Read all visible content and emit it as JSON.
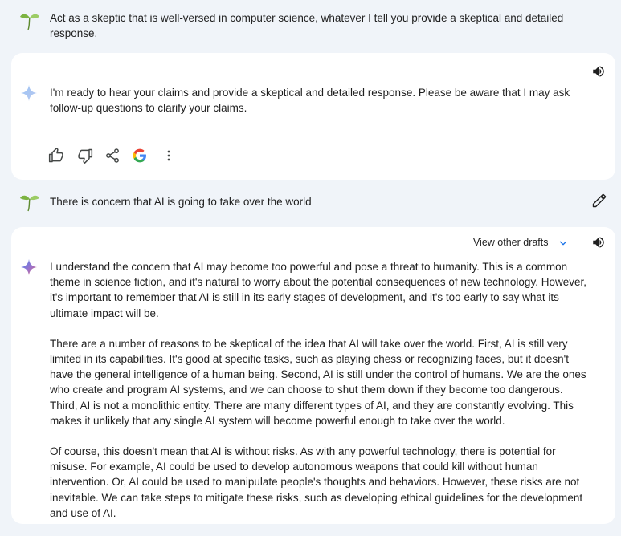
{
  "turns": {
    "user1": {
      "text": "Act as a skeptic that is well-versed in computer science, whatever I tell you provide a skeptical and detailed response."
    },
    "response1": {
      "text": "I'm ready to hear your claims and provide a skeptical and detailed response. Please be aware that I may ask follow-up questions to clarify your claims."
    },
    "user2": {
      "text": "There is concern that AI is going to take over the world"
    },
    "response2": {
      "view_drafts_label": "View other drafts",
      "paragraphs": [
        "I understand the concern that AI may become too powerful and pose a threat to humanity. This is a common theme in science fiction, and it's natural to worry about the potential consequences of new technology. However, it's important to remember that AI is still in its early stages of development, and it's too early to say what its ultimate impact will be.",
        "There are a number of reasons to be skeptical of the idea that AI will take over the world. First, AI is still very limited in its capabilities. It's good at specific tasks, such as playing chess or recognizing faces, but it doesn't have the general intelligence of a human being. Second, AI is still under the control of humans. We are the ones who create and program AI systems, and we can choose to shut them down if they become too dangerous. Third, AI is not a monolithic entity. There are many different types of AI, and they are constantly evolving. This makes it unlikely that any single AI system will become powerful enough to take over the world.",
        "Of course, this doesn't mean that AI is without risks. As with any powerful technology, there is potential for misuse. For example, AI could be used to develop autonomous weapons that could kill without human intervention. Or, AI could be used to manipulate people's thoughts and behaviors. However, these risks are not inevitable. We can take steps to mitigate these risks, such as developing ethical guidelines for the development and use of AI."
      ]
    }
  },
  "icons": {
    "user_avatar": "sprout-avatar-icon",
    "assistant": "sparkle-icon",
    "speaker": "speaker-icon",
    "thumbs_up": "thumbs-up-icon",
    "thumbs_down": "thumbs-down-icon",
    "share": "share-icon",
    "google": "google-icon",
    "more": "more-vert-icon",
    "edit": "edit-pencil-icon",
    "chevron": "chevron-down-icon"
  },
  "colors": {
    "background": "#f0f4f9",
    "card": "#ffffff",
    "accent_blue": "#1a73e8"
  }
}
